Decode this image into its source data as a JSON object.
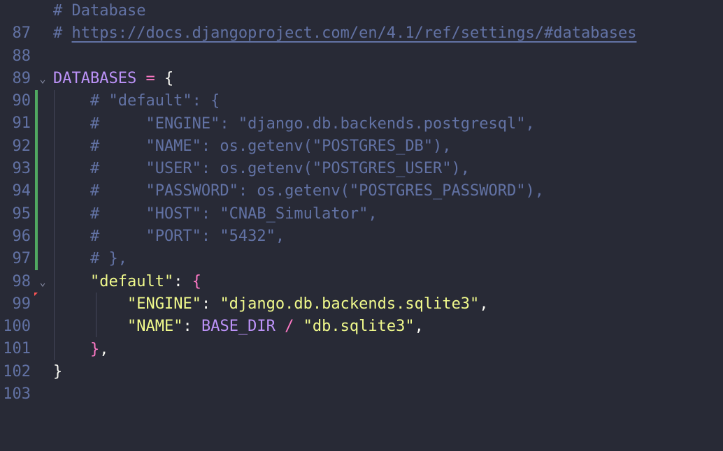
{
  "editor": {
    "lines": [
      {
        "no": "87",
        "c1": "# Database"
      },
      {
        "no": "88",
        "c1": "# ",
        "link": "https://docs.djangoproject.com/en/4.1/ref/settings/#databases"
      },
      {
        "no": "89"
      },
      {
        "no": "90",
        "fold": "⌄",
        "name": "DATABASES",
        "op": " = ",
        "brace": "{"
      },
      {
        "no": "91",
        "c1": "    # \"default\": {"
      },
      {
        "no": "92",
        "c1": "    #     \"ENGINE\": \"django.db.backends.postgresql\","
      },
      {
        "no": "93",
        "c1": "    #     \"NAME\": os.getenv(\"POSTGRES_DB\"),"
      },
      {
        "no": "94",
        "c1": "    #     \"USER\": os.getenv(\"POSTGRES_USER\"),"
      },
      {
        "no": "95",
        "c1": "    #     \"PASSWORD\": os.getenv(\"POSTGRES_PASSWORD\"),"
      },
      {
        "no": "96",
        "c1": "    #     \"HOST\": \"CNAB_Simulator\","
      },
      {
        "no": "97",
        "c1": "    #     \"PORT\": \"5432\","
      },
      {
        "no": "98",
        "c1": "    # },"
      },
      {
        "no": "99",
        "fold": "⌄",
        "indent": "    ",
        "key": "\"default\"",
        "colon": ": ",
        "brace": "{"
      },
      {
        "no": "100",
        "indent": "        ",
        "key": "\"ENGINE\"",
        "colon": ": ",
        "val": "\"django.db.backends.sqlite3\"",
        "end": ","
      },
      {
        "no": "101",
        "indent": "        ",
        "key": "\"NAME\"",
        "colon": ": ",
        "name": "BASE_DIR",
        "op": " / ",
        "val": "\"db.sqlite3\"",
        "end": ","
      },
      {
        "no": "102",
        "indent": "    ",
        "brace": "}",
        "end": ","
      },
      {
        "no": "103",
        "brace": "}"
      }
    ]
  }
}
